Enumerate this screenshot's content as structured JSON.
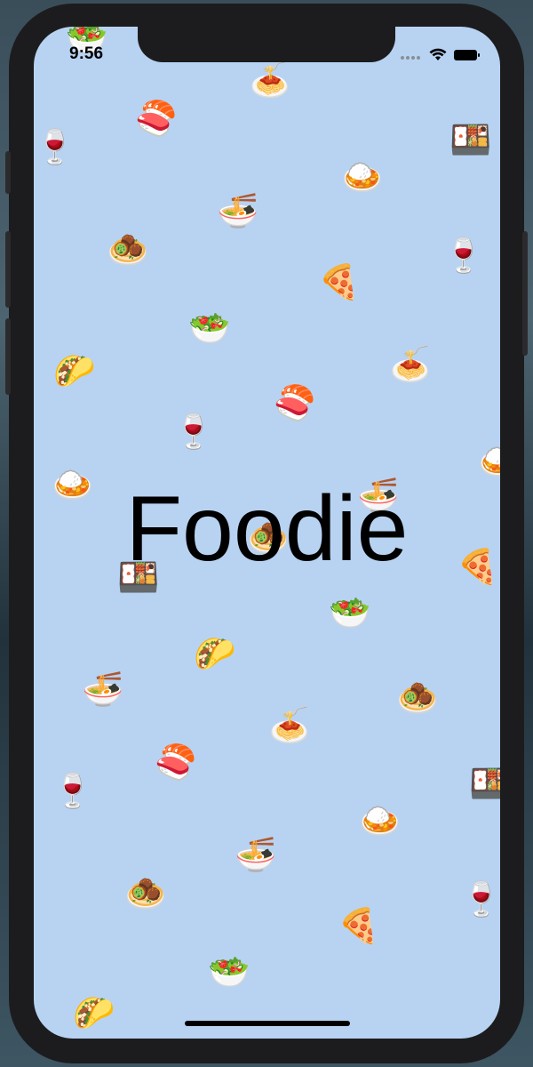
{
  "status_bar": {
    "time": "9:56",
    "wifi_icon": "wifi-icon",
    "battery_icon": "battery-icon"
  },
  "app": {
    "title": "Foodie"
  },
  "background_color": "#b8d3f2",
  "food_icons": [
    "salad",
    "spaghetti",
    "sushi",
    "wine-glass",
    "bento-box",
    "rice-curry",
    "ramen",
    "falafel",
    "wine-glass",
    "pizza",
    "salad",
    "taco",
    "spaghetti",
    "sushi",
    "wine-glass",
    "rice-curry",
    "rice-curry",
    "ramen",
    "falafel",
    "pizza",
    "bento-box",
    "salad",
    "taco",
    "ramen",
    "falafel",
    "spaghetti",
    "sushi",
    "wine-glass",
    "bento-box",
    "rice-curry",
    "ramen",
    "falafel",
    "wine-glass",
    "pizza",
    "salad",
    "taco"
  ]
}
